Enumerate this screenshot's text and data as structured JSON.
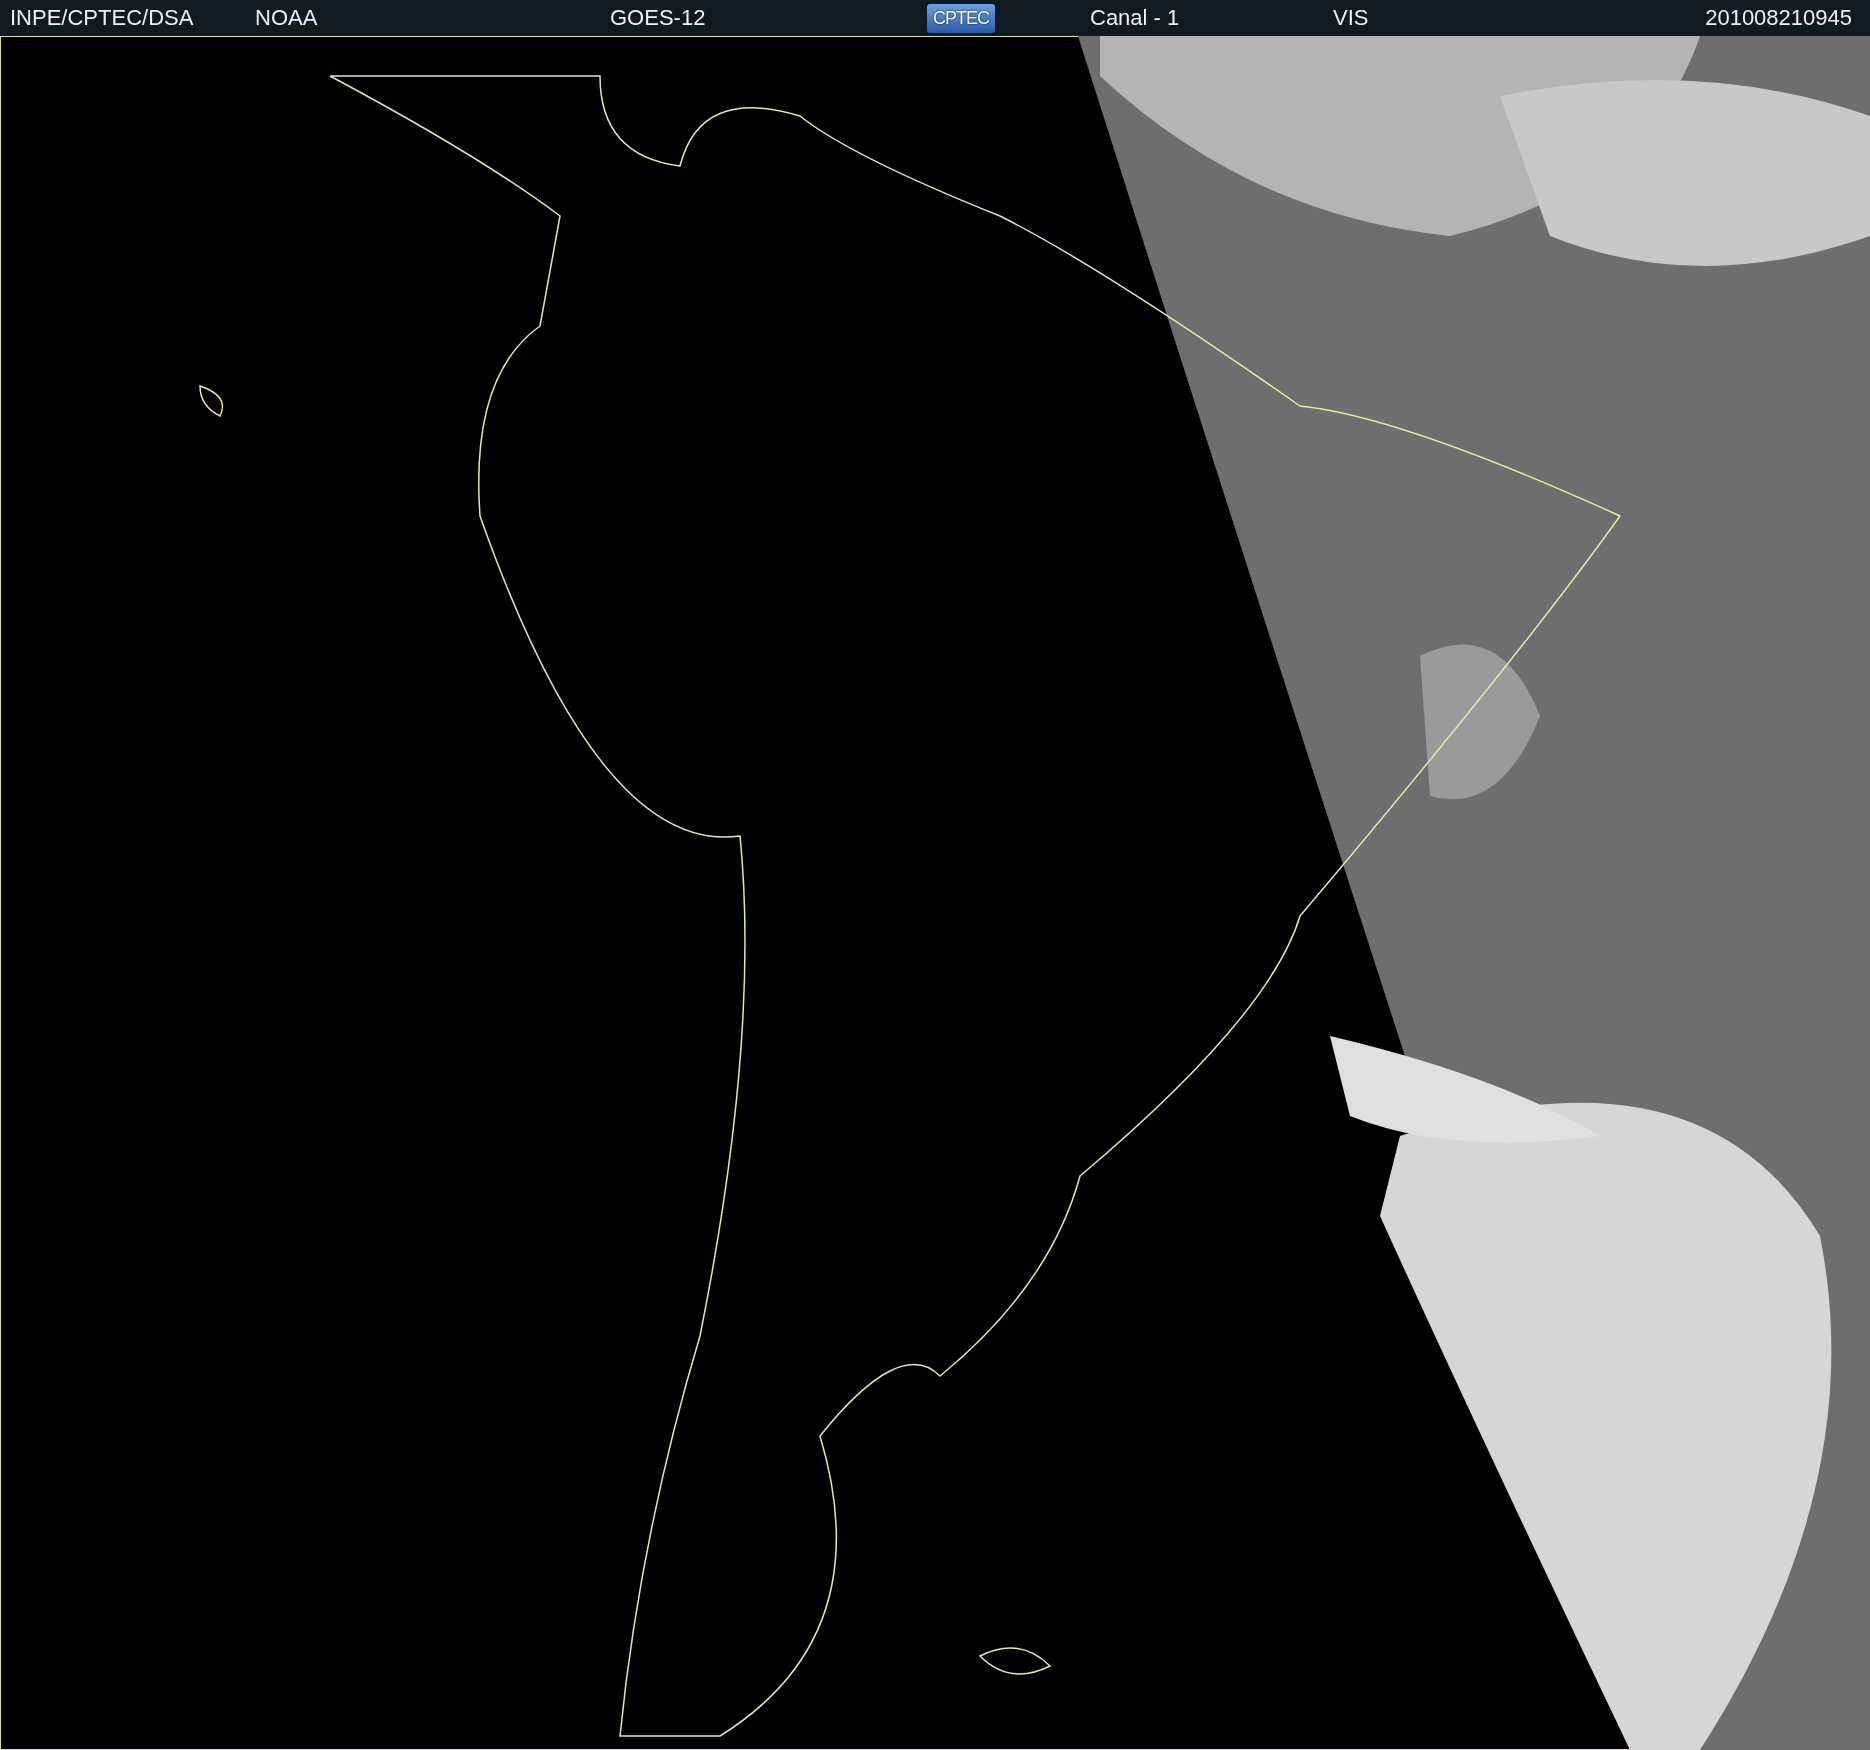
{
  "header": {
    "items": [
      {
        "kind": "text",
        "text": "INPE/CPTEC/DSA"
      },
      {
        "kind": "text",
        "text": "NOAA"
      },
      {
        "kind": "text",
        "text": "GOES-12"
      },
      {
        "kind": "logo",
        "text": "CPTEC"
      },
      {
        "kind": "text",
        "text": "Canal - 1"
      },
      {
        "kind": "text",
        "text": "VIS"
      },
      {
        "kind": "text",
        "text": "201008210945"
      }
    ]
  }
}
